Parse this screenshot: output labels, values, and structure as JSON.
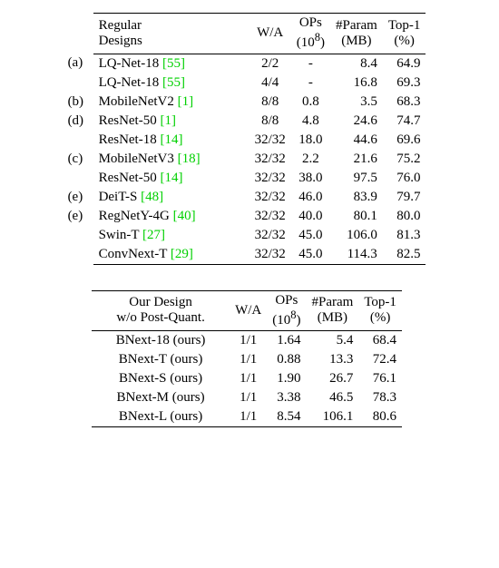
{
  "table1": {
    "headers": {
      "designs_l1": "Regular",
      "designs_l2": "Designs",
      "wa": "W/A",
      "ops_l1": "OPs",
      "ops_l2": "(10",
      "ops_sup": "8",
      "ops_l2_close": ")",
      "param_l1": "#Param",
      "param_l2": "(MB)",
      "top1_l1": "Top-1",
      "top1_l2": "(%)"
    },
    "rows": [
      {
        "tag": "(a)",
        "name": "LQ-Net-18 ",
        "cite": "[55]",
        "wa": "2/2",
        "ops": "-",
        "param": "8.4",
        "top1": "64.9"
      },
      {
        "tag": "",
        "name": "LQ-Net-18 ",
        "cite": "[55]",
        "wa": "4/4",
        "ops": "-",
        "param": "16.8",
        "top1": "69.3"
      },
      {
        "tag": "(b)",
        "name": "MobileNetV2 ",
        "cite": "[1]",
        "wa": "8/8",
        "ops": "0.8",
        "param": "3.5",
        "top1": "68.3"
      },
      {
        "tag": "(d)",
        "name": "ResNet-50 ",
        "cite": "[1]",
        "wa": "8/8",
        "ops": "4.8",
        "param": "24.6",
        "top1": "74.7"
      },
      {
        "tag": "",
        "name": "ResNet-18 ",
        "cite": "[14]",
        "wa": "32/32",
        "ops": "18.0",
        "param": "44.6",
        "top1": "69.6"
      },
      {
        "tag": "(c)",
        "name": "MobileNetV3 ",
        "cite": "[18]",
        "wa": "32/32",
        "ops": "2.2",
        "param": "21.6",
        "top1": "75.2"
      },
      {
        "tag": "",
        "name": "ResNet-50 ",
        "cite": "[14]",
        "wa": "32/32",
        "ops": "38.0",
        "param": "97.5",
        "top1": "76.0"
      },
      {
        "tag": "(e)",
        "name": "DeiT-S ",
        "cite": "[48]",
        "wa": "32/32",
        "ops": "46.0",
        "param": "83.9",
        "top1": "79.7"
      },
      {
        "tag": "(e)",
        "name": "RegNetY-4G ",
        "cite": "[40]",
        "wa": "32/32",
        "ops": "40.0",
        "param": "80.1",
        "top1": "80.0"
      },
      {
        "tag": "",
        "name": "Swin-T ",
        "cite": "[27]",
        "wa": "32/32",
        "ops": "45.0",
        "param": "106.0",
        "top1": "81.3"
      },
      {
        "tag": "",
        "name": "ConvNext-T ",
        "cite": "[29]",
        "wa": "32/32",
        "ops": "45.0",
        "param": "114.3",
        "top1": "82.5"
      }
    ]
  },
  "table2": {
    "headers": {
      "designs_l1": "Our Design",
      "designs_l2": "w/o Post-Quant.",
      "wa": "W/A",
      "ops_l1": "OPs",
      "ops_l2": "(10",
      "ops_sup": "8",
      "ops_l2_close": ")",
      "param_l1": "#Param",
      "param_l2": "(MB)",
      "top1_l1": "Top-1",
      "top1_l2": "(%)"
    },
    "rows": [
      {
        "name": "BNext-18 (ours)",
        "wa": "1/1",
        "ops": "1.64",
        "param": "5.4",
        "top1": "68.4"
      },
      {
        "name": "BNext-T (ours)",
        "wa": "1/1",
        "ops": "0.88",
        "param": "13.3",
        "top1": "72.4"
      },
      {
        "name": "BNext-S (ours)",
        "wa": "1/1",
        "ops": "1.90",
        "param": "26.7",
        "top1": "76.1"
      },
      {
        "name": "BNext-M (ours)",
        "wa": "1/1",
        "ops": "3.38",
        "param": "46.5",
        "top1": "78.3"
      },
      {
        "name": "BNext-L (ours)",
        "wa": "1/1",
        "ops": "8.54",
        "param": "106.1",
        "top1": "80.6"
      }
    ]
  },
  "chart_data": [
    {
      "type": "table",
      "title": "Regular Designs",
      "columns": [
        "tag",
        "Design",
        "W/A",
        "OPs (1e8)",
        "#Param (MB)",
        "Top-1 (%)"
      ],
      "rows": [
        [
          "(a)",
          "LQ-Net-18 [55]",
          "2/2",
          null,
          8.4,
          64.9
        ],
        [
          "",
          "LQ-Net-18 [55]",
          "4/4",
          null,
          16.8,
          69.3
        ],
        [
          "(b)",
          "MobileNetV2 [1]",
          "8/8",
          0.8,
          3.5,
          68.3
        ],
        [
          "(d)",
          "ResNet-50 [1]",
          "8/8",
          4.8,
          24.6,
          74.7
        ],
        [
          "",
          "ResNet-18 [14]",
          "32/32",
          18.0,
          44.6,
          69.6
        ],
        [
          "(c)",
          "MobileNetV3 [18]",
          "32/32",
          2.2,
          21.6,
          75.2
        ],
        [
          "",
          "ResNet-50 [14]",
          "32/32",
          38.0,
          97.5,
          76.0
        ],
        [
          "(e)",
          "DeiT-S [48]",
          "32/32",
          46.0,
          83.9,
          79.7
        ],
        [
          "(e)",
          "RegNetY-4G [40]",
          "32/32",
          40.0,
          80.1,
          80.0
        ],
        [
          "",
          "Swin-T [27]",
          "32/32",
          45.0,
          106.0,
          81.3
        ],
        [
          "",
          "ConvNext-T [29]",
          "32/32",
          45.0,
          114.3,
          82.5
        ]
      ]
    },
    {
      "type": "table",
      "title": "Our Design w/o Post-Quant.",
      "columns": [
        "Design",
        "W/A",
        "OPs (1e8)",
        "#Param (MB)",
        "Top-1 (%)"
      ],
      "rows": [
        [
          "BNext-18 (ours)",
          "1/1",
          1.64,
          5.4,
          68.4
        ],
        [
          "BNext-T (ours)",
          "1/1",
          0.88,
          13.3,
          72.4
        ],
        [
          "BNext-S (ours)",
          "1/1",
          1.9,
          26.7,
          76.1
        ],
        [
          "BNext-M (ours)",
          "1/1",
          3.38,
          46.5,
          78.3
        ],
        [
          "BNext-L (ours)",
          "1/1",
          8.54,
          106.1,
          80.6
        ]
      ]
    }
  ]
}
